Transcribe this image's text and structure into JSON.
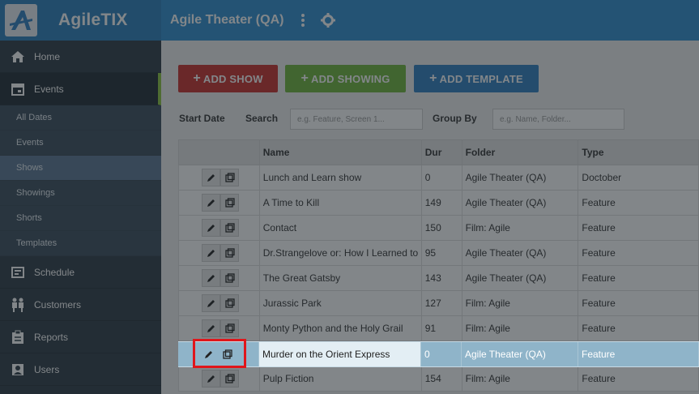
{
  "header": {
    "brand": "AgileTIX",
    "venue": "Agile Theater (QA)",
    "icons": [
      "more-vert-icon",
      "gear-icon"
    ]
  },
  "sidebar": {
    "items": [
      {
        "label": "Home",
        "icon": "home-icon"
      },
      {
        "label": "Events",
        "icon": "calendar-icon"
      },
      {
        "label": "Schedule",
        "icon": "schedule-icon"
      },
      {
        "label": "Customers",
        "icon": "customers-icon"
      },
      {
        "label": "Reports",
        "icon": "clipboard-icon"
      },
      {
        "label": "Users",
        "icon": "user-icon"
      }
    ],
    "events_sub": [
      "All Dates",
      "Events",
      "Shows",
      "Showings",
      "Shorts",
      "Templates"
    ],
    "selected_sub": "Shows"
  },
  "toolbar": {
    "add_show": "ADD SHOW",
    "add_showing": "ADD SHOWING",
    "add_template": "ADD TEMPLATE"
  },
  "filters": {
    "start_date_label": "Start Date",
    "search_label": "Search",
    "search_placeholder": "e.g. Feature, Screen 1...",
    "group_by_label": "Group By",
    "group_by_placeholder": "e.g. Name, Folder..."
  },
  "table": {
    "columns": [
      "Name",
      "Dur",
      "Folder",
      "Type"
    ],
    "rows": [
      {
        "name": "Lunch and Learn show",
        "dur": "0",
        "folder": "Agile Theater (QA)",
        "type": "Doctober"
      },
      {
        "name": "A Time to Kill",
        "dur": "149",
        "folder": "Agile Theater (QA)",
        "type": "Feature"
      },
      {
        "name": "Contact",
        "dur": "150",
        "folder": "Film: Agile",
        "type": "Feature"
      },
      {
        "name": "Dr.Strangelove or: How I Learned to",
        "dur": "95",
        "folder": "Agile Theater (QA)",
        "type": "Feature"
      },
      {
        "name": "The Great Gatsby",
        "dur": "143",
        "folder": "Agile Theater (QA)",
        "type": "Feature"
      },
      {
        "name": "Jurassic Park",
        "dur": "127",
        "folder": "Film: Agile",
        "type": "Feature"
      },
      {
        "name": "Monty Python and the Holy Grail",
        "dur": "91",
        "folder": "Film: Agile",
        "type": "Feature"
      },
      {
        "name": "Murder on the Orient Express",
        "dur": "0",
        "folder": "Agile Theater (QA)",
        "type": "Feature"
      },
      {
        "name": "Pulp Fiction",
        "dur": "154",
        "folder": "Film: Agile",
        "type": "Feature"
      }
    ],
    "highlighted_row": 7
  },
  "colors": {
    "header": "#2f8fd0",
    "sidebar": "#2d3a45",
    "add_show": "#c9302c",
    "add_showing": "#6fb63a",
    "add_template": "#2f7ec1",
    "focus_box": "#e0161b"
  }
}
